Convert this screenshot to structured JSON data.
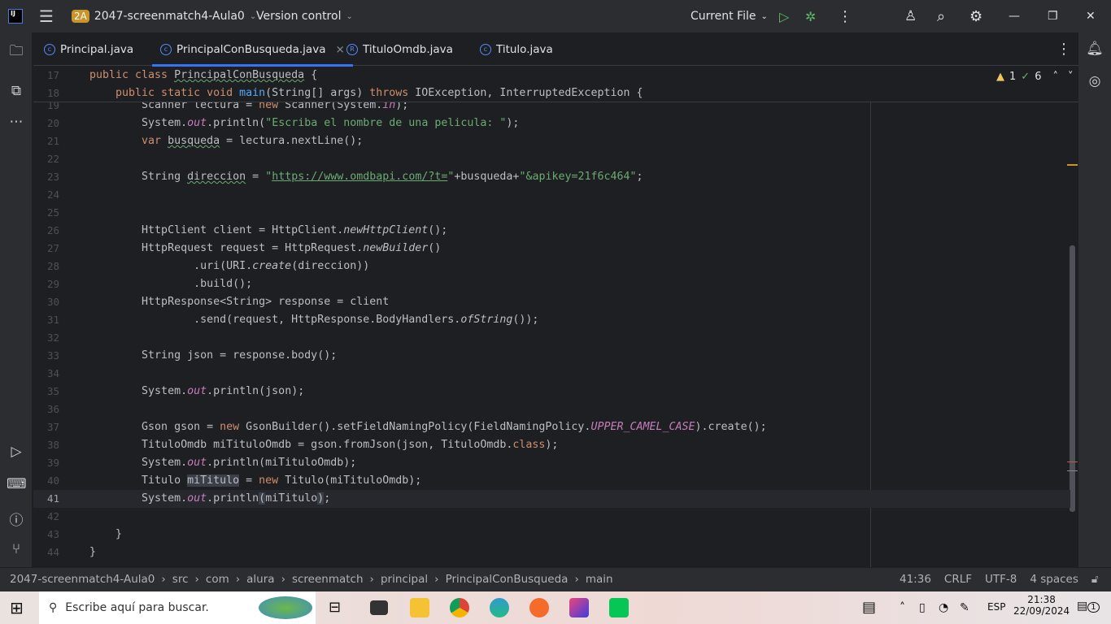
{
  "titlebar": {
    "project_badge": "2A",
    "project": "2047-screenmatch4-Aula0",
    "vcs": "Version control",
    "run_config": "Current File"
  },
  "tabs": [
    {
      "label": "Principal.java"
    },
    {
      "label": "PrincipalConBusqueda.java",
      "active": true
    },
    {
      "label": "TituloOmdb.java"
    },
    {
      "label": "Titulo.java"
    }
  ],
  "inspections": {
    "warnings": "1",
    "ok": "6"
  },
  "sticky": [
    {
      "n": "17",
      "tokens": [
        [
          "public class ",
          "kw"
        ],
        [
          "PrincipalConBusqueda",
          "und"
        ],
        [
          " {",
          ""
        ]
      ]
    },
    {
      "n": "18",
      "tokens": [
        [
          "    public static void ",
          "kw"
        ],
        [
          "main",
          "fn"
        ],
        [
          "(String[] args) ",
          ""
        ],
        [
          "throws ",
          "kw"
        ],
        [
          "IOException, InterruptedException {",
          ""
        ]
      ]
    }
  ],
  "code": [
    {
      "n": "19",
      "tokens": [
        [
          "        Scanner lectura = ",
          ""
        ],
        [
          "new ",
          "kw"
        ],
        [
          "Scanner(System.",
          ""
        ],
        [
          "in",
          "st"
        ],
        [
          ");",
          ""
        ]
      ]
    },
    {
      "n": "20",
      "tokens": [
        [
          "        System.",
          ""
        ],
        [
          "out",
          "st"
        ],
        [
          ".println(",
          ""
        ],
        [
          "\"Escriba el nombre de una pelicula: \"",
          "str"
        ],
        [
          ");",
          ""
        ]
      ]
    },
    {
      "n": "21",
      "tokens": [
        [
          "        ",
          ""
        ],
        [
          "var ",
          "kw"
        ],
        [
          "busqueda",
          "und"
        ],
        [
          " = lectura.nextLine();",
          ""
        ]
      ]
    },
    {
      "n": "22",
      "tokens": []
    },
    {
      "n": "23",
      "tokens": [
        [
          "        String ",
          ""
        ],
        [
          "direccion",
          "und"
        ],
        [
          " = ",
          ""
        ],
        [
          "\"",
          "str"
        ],
        [
          "https://www.omdbapi.com/?t=",
          "url"
        ],
        [
          "\"",
          "str"
        ],
        [
          "+busqueda+",
          ""
        ],
        [
          "\"&apikey=21f6c464\"",
          "str"
        ],
        [
          ";",
          ""
        ]
      ]
    },
    {
      "n": "24",
      "tokens": []
    },
    {
      "n": "25",
      "tokens": []
    },
    {
      "n": "26",
      "tokens": [
        [
          "        HttpClient client = HttpClient.",
          ""
        ],
        [
          "newHttpClient",
          "it"
        ],
        [
          "();",
          ""
        ]
      ]
    },
    {
      "n": "27",
      "tokens": [
        [
          "        HttpRequest request = HttpRequest.",
          ""
        ],
        [
          "newBuilder",
          "it"
        ],
        [
          "()",
          ""
        ]
      ]
    },
    {
      "n": "28",
      "tokens": [
        [
          "                .uri(URI.",
          ""
        ],
        [
          "create",
          "it"
        ],
        [
          "(direccion))",
          ""
        ]
      ]
    },
    {
      "n": "29",
      "tokens": [
        [
          "                .build();",
          ""
        ]
      ]
    },
    {
      "n": "30",
      "tokens": [
        [
          "        HttpResponse<String> response = client",
          ""
        ]
      ]
    },
    {
      "n": "31",
      "tokens": [
        [
          "                .send(request, HttpResponse.BodyHandlers.",
          ""
        ],
        [
          "ofString",
          "it"
        ],
        [
          "());",
          ""
        ]
      ]
    },
    {
      "n": "32",
      "tokens": []
    },
    {
      "n": "33",
      "tokens": [
        [
          "        String json = response.body();",
          ""
        ]
      ]
    },
    {
      "n": "34",
      "tokens": []
    },
    {
      "n": "35",
      "tokens": [
        [
          "        System.",
          ""
        ],
        [
          "out",
          "st"
        ],
        [
          ".println(json);",
          ""
        ]
      ]
    },
    {
      "n": "36",
      "tokens": []
    },
    {
      "n": "37",
      "tokens": [
        [
          "        Gson gson = ",
          ""
        ],
        [
          "new ",
          "kw"
        ],
        [
          "GsonBuilder().setFieldNamingPolicy(FieldNamingPolicy.",
          ""
        ],
        [
          "UPPER_CAMEL_CASE",
          "st"
        ],
        [
          ").create();",
          ""
        ]
      ]
    },
    {
      "n": "38",
      "tokens": [
        [
          "        TituloOmdb miTituloOmdb = gson.fromJson(json, TituloOmdb.",
          ""
        ],
        [
          "class",
          "kw"
        ],
        [
          ");",
          ""
        ]
      ]
    },
    {
      "n": "39",
      "tokens": [
        [
          "        System.",
          ""
        ],
        [
          "out",
          "st"
        ],
        [
          ".println(miTituloOmdb);",
          ""
        ]
      ]
    },
    {
      "n": "40",
      "tokens": [
        [
          "        Titulo ",
          ""
        ],
        [
          "miTitulo",
          "hl"
        ],
        [
          " = ",
          ""
        ],
        [
          "new ",
          "kw"
        ],
        [
          "Titulo(miTituloOmdb);",
          ""
        ]
      ]
    },
    {
      "n": "41",
      "tokens": [
        [
          "        System.",
          ""
        ],
        [
          "out",
          "st"
        ],
        [
          ".println",
          ""
        ],
        [
          "(",
          "hl"
        ],
        [
          "miTitulo",
          ""
        ],
        [
          ")",
          "hl"
        ],
        [
          ";",
          ""
        ]
      ],
      "current": true
    },
    {
      "n": "42",
      "tokens": []
    },
    {
      "n": "43",
      "tokens": [
        [
          "    }",
          ""
        ]
      ]
    },
    {
      "n": "44",
      "tokens": [
        [
          "}",
          ""
        ]
      ]
    }
  ],
  "breadcrumb": [
    "2047-screenmatch4-Aula0",
    "src",
    "com",
    "alura",
    "screenmatch",
    "principal",
    "PrincipalConBusqueda",
    "main"
  ],
  "status": {
    "position": "41:36",
    "line_sep": "CRLF",
    "encoding": "UTF-8",
    "indent": "4 spaces"
  },
  "taskbar": {
    "search_placeholder": "Escribe aquí para buscar.",
    "lang": "ESP",
    "time": "21:38",
    "date": "22/09/2024",
    "notifications": "1"
  }
}
